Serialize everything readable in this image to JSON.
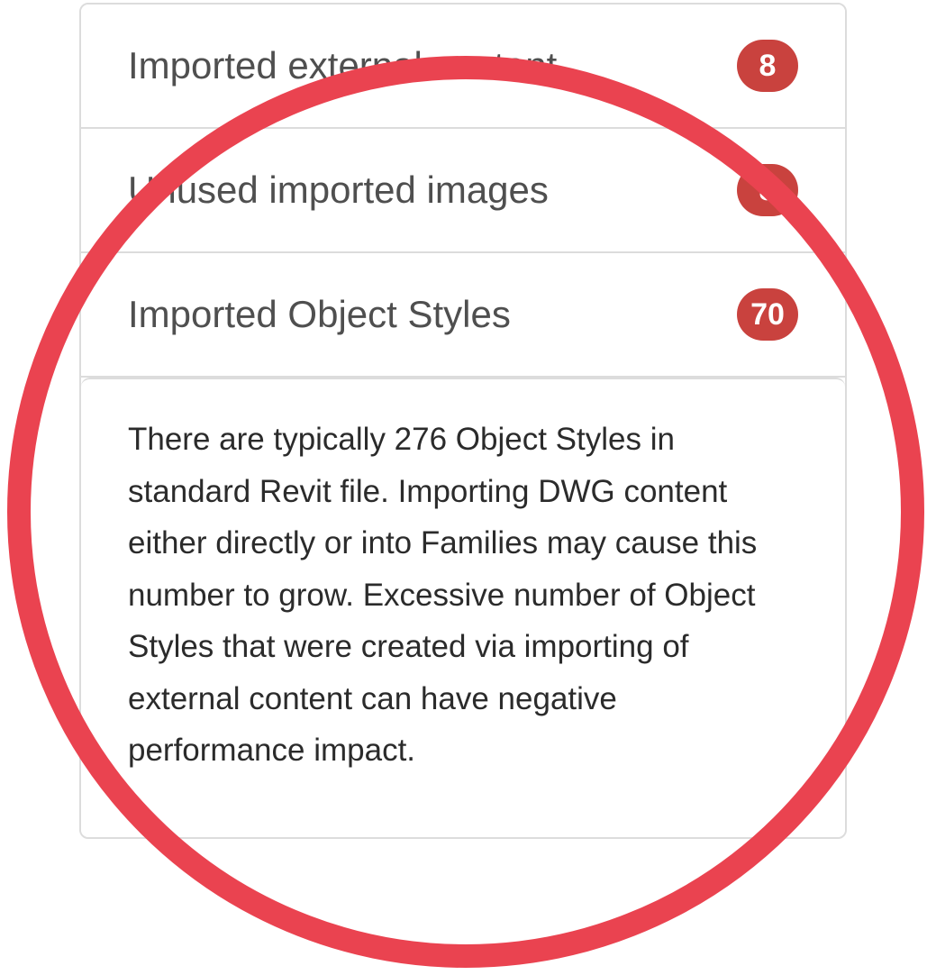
{
  "list": {
    "items": [
      {
        "label": "Imported external content",
        "count": "8"
      },
      {
        "label": "Unused imported images",
        "count": "8"
      },
      {
        "label": "Imported Object Styles",
        "count": "70"
      }
    ]
  },
  "detail": {
    "text": "There are typically 276 Object Styles in standard Revit file. Importing DWG content either directly or into Families may cause this number to grow. Excessive number of Object Styles that were created via importing of external content can have negative performance impact."
  },
  "annotation": {
    "circle_color": "#ea4350"
  }
}
